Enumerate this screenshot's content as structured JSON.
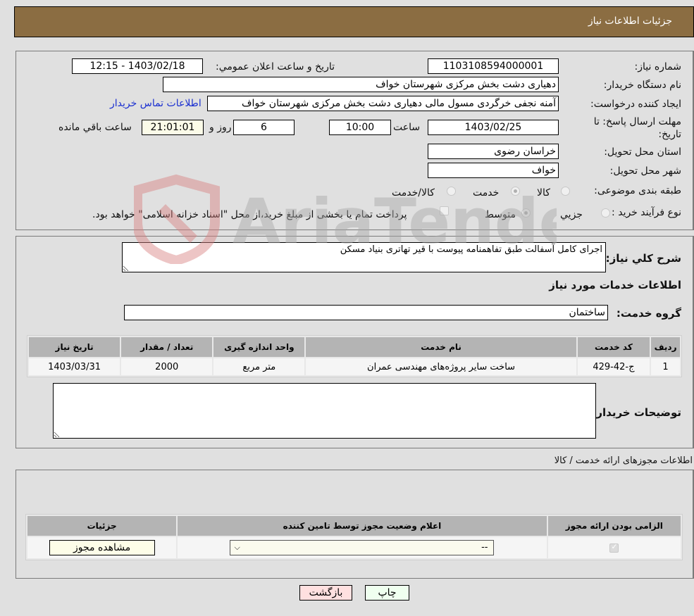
{
  "header": {
    "title": "جزئیات اطلاعات نیاز"
  },
  "form": {
    "need_number_label": "شماره نیاز:",
    "need_number": "1103108594000001",
    "announce_label": "تاریخ و ساعت اعلان عمومي:",
    "announce_value": "1403/02/18 - 12:15",
    "buyer_org_label": "نام دستگاه خریدار:",
    "buyer_org": "دهیاری دشت بخش مرکزی شهرستان خواف",
    "creator_label": "ایجاد کننده درخواست:",
    "creator": "آمنه نجفی خرگردی مسول مالی دهیاری دشت بخش مرکزی شهرستان خواف",
    "contact_link": "اطلاعات تماس خریدار",
    "deadline_label_1": "مهلت ارسال پاسخ: تا",
    "deadline_label_2": "تاریخ:",
    "deadline_date": "1403/02/25",
    "time_label": "ساعت",
    "deadline_time": "10:00",
    "days_value": "6",
    "days_label": "روز و",
    "remaining_time": "21:01:01",
    "remaining_label": "ساعت باقي مانده",
    "province_label": "استان محل تحویل:",
    "province": "خراسان رضوی",
    "city_label": "شهر محل تحویل:",
    "city": "خواف",
    "category_label": "طبقه بندی موضوعی:",
    "category_options": [
      {
        "label": "کالا",
        "checked": false
      },
      {
        "label": "خدمت",
        "checked": true
      },
      {
        "label": "کالا/خدمت",
        "checked": false
      }
    ],
    "process_label": "نوع فرآیند خرید :",
    "process_options": [
      {
        "label": "جزیي",
        "checked": false
      },
      {
        "label": "متوسط",
        "checked": true
      }
    ],
    "treasury_checkbox_label": "پرداخت تمام یا بخشی از مبلغ خرید،از محل \"اسناد خزانه اسلامی\" خواهد بود.",
    "treasury_checked": false
  },
  "description": {
    "label": "شرح کلي نیاز:",
    "value": "اجرای کامل آسفالت طبق تفاهمنامه پیوست با قیر تهاتری بنیاد مسکن",
    "services_title": "اطلاعات خدمات مورد نیاز",
    "group_label": "گروه خدمت:",
    "group_value": "ساختمان"
  },
  "services_table": {
    "headers": [
      "ردیف",
      "کد خدمت",
      "نام خدمت",
      "واحد اندازه گیری",
      "تعداد / مقدار",
      "تاریخ نیاز"
    ],
    "rows": [
      [
        "1",
        "ج-42-429",
        "ساخت سایر پروژه‌های مهندسی عمران",
        "متر مربع",
        "2000",
        "1403/03/31"
      ]
    ]
  },
  "buyer_notes": {
    "label": "توضیحات خریدار:",
    "value": ""
  },
  "permits": {
    "title": "اطلاعات مجوزهای ارائه خدمت / کالا",
    "headers": [
      "الزامی بودن ارائه مجوز",
      "اعلام وضعیت مجوز توسط تامین کننده",
      "جزئیات"
    ],
    "row": {
      "required_checked": true,
      "status_value": "--",
      "details_button": "مشاهده مجوز"
    }
  },
  "buttons": {
    "print": "چاپ",
    "back": "بازگشت"
  },
  "watermark": {
    "text": "AriaTender.neT"
  }
}
